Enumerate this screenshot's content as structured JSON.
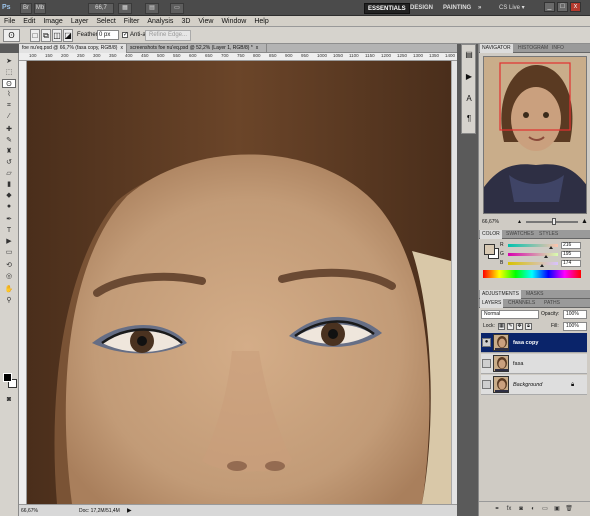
{
  "app": {
    "logo": "Ps",
    "zoom_select": "66,7",
    "workspaces": [
      "ESSENTIALS",
      "DESIGN",
      "PAINTING",
      "»"
    ],
    "cs_live": "CS Live ▾",
    "window_buttons": [
      "_",
      "□",
      "x"
    ]
  },
  "menu": [
    "File",
    "Edit",
    "Image",
    "Layer",
    "Select",
    "Filter",
    "Analysis",
    "3D",
    "View",
    "Window",
    "Help"
  ],
  "options": {
    "feather_label": "Feather:",
    "feather_value": "0 px",
    "antialias_label": "Anti-alias",
    "refine_edge": "Refine Edge..."
  },
  "doc_tabs": [
    {
      "label": "foe nu'eq.psd @ 66,7% (fasa copy, RGB/8)",
      "close": "x"
    },
    {
      "label": "screenshots foe nu'eq.psd @ 52,2% (Layer 1, RGB/8) *",
      "close": "x"
    }
  ],
  "ruler_ticks": [
    "100",
    "150",
    "200",
    "250",
    "300",
    "350",
    "400",
    "450",
    "500",
    "550",
    "600",
    "650",
    "700",
    "750",
    "800",
    "850",
    "900",
    "950",
    "1000",
    "1050",
    "1100",
    "1150",
    "1200",
    "1250",
    "1300",
    "1350",
    "1400"
  ],
  "status": {
    "zoom": "66,67%",
    "doc": "Doc: 17,2M/51,4M"
  },
  "navigator": {
    "tabs": [
      "NAVIGATOR",
      "HISTOGRAM",
      "INFO"
    ],
    "zoom": "66,67%"
  },
  "color": {
    "tabs": [
      "COLOR",
      "SWATCHES",
      "STYLES"
    ],
    "channels": [
      {
        "label": "R",
        "value": "216",
        "level": 0.85
      },
      {
        "label": "G",
        "value": "195",
        "level": 0.76
      },
      {
        "label": "B",
        "value": "174",
        "level": 0.68
      }
    ]
  },
  "adjustments": {
    "tabs": [
      "ADJUSTMENTS",
      "MASKS"
    ]
  },
  "layers": {
    "tabs": [
      "LAYERS",
      "CHANNELS",
      "PATHS"
    ],
    "blend_mode": "Normal",
    "opacity_label": "Opacity:",
    "opacity": "100%",
    "lock_label": "Lock:",
    "fill_label": "Fill:",
    "fill": "100%",
    "items": [
      {
        "name": "fasa copy",
        "active": true,
        "visible": true
      },
      {
        "name": "fasa",
        "active": false,
        "visible": false
      },
      {
        "name": "Background",
        "active": false,
        "visible": false,
        "locked": true
      }
    ]
  },
  "colors": {
    "accent": "#0a246a",
    "skin": "#c9a37f",
    "hair": "#5b3a22"
  }
}
